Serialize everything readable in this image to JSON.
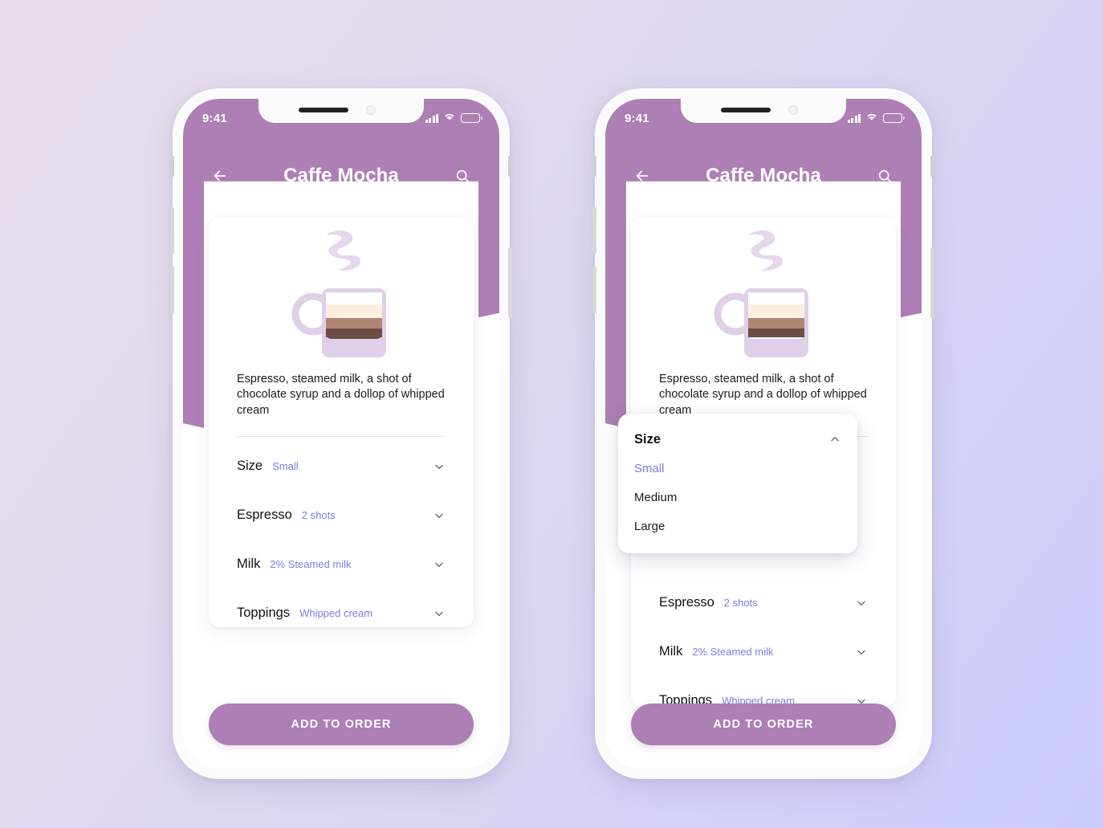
{
  "accent_colors": {
    "header_purple": "#ad7fb5",
    "value_text": "#7b7ce0",
    "card_white": "#ffffff",
    "background_start": "#e7dce9",
    "background_end": "#ccccfc"
  },
  "status_bar": {
    "time": "9:41",
    "signal_icon": "signal-bars-icon",
    "wifi_icon": "wifi-icon",
    "battery_icon": "battery-icon"
  },
  "nav": {
    "back_icon": "arrow-left-icon",
    "title": "Caffe Mocha",
    "search_icon": "search-icon"
  },
  "product": {
    "image_icon": "coffee-cup-illustration",
    "description": "Espresso, steamed milk, a shot of chocolate syrup and a dollop of whipped cream"
  },
  "options": [
    {
      "label": "Size",
      "value": "Small",
      "chevron": "chevron-down-icon"
    },
    {
      "label": "Espresso",
      "value": "2 shots",
      "chevron": "chevron-down-icon"
    },
    {
      "label": "Milk",
      "value": "2% Steamed milk",
      "chevron": "chevron-down-icon"
    },
    {
      "label": "Toppings",
      "value": "Whipped cream",
      "chevron": "chevron-down-icon"
    }
  ],
  "dropdown": {
    "title": "Size",
    "chevron": "chevron-up-icon",
    "items": [
      {
        "label": "Small",
        "selected": true
      },
      {
        "label": "Medium",
        "selected": false
      },
      {
        "label": "Large",
        "selected": false
      }
    ]
  },
  "cta": {
    "label": "ADD TO ORDER"
  }
}
